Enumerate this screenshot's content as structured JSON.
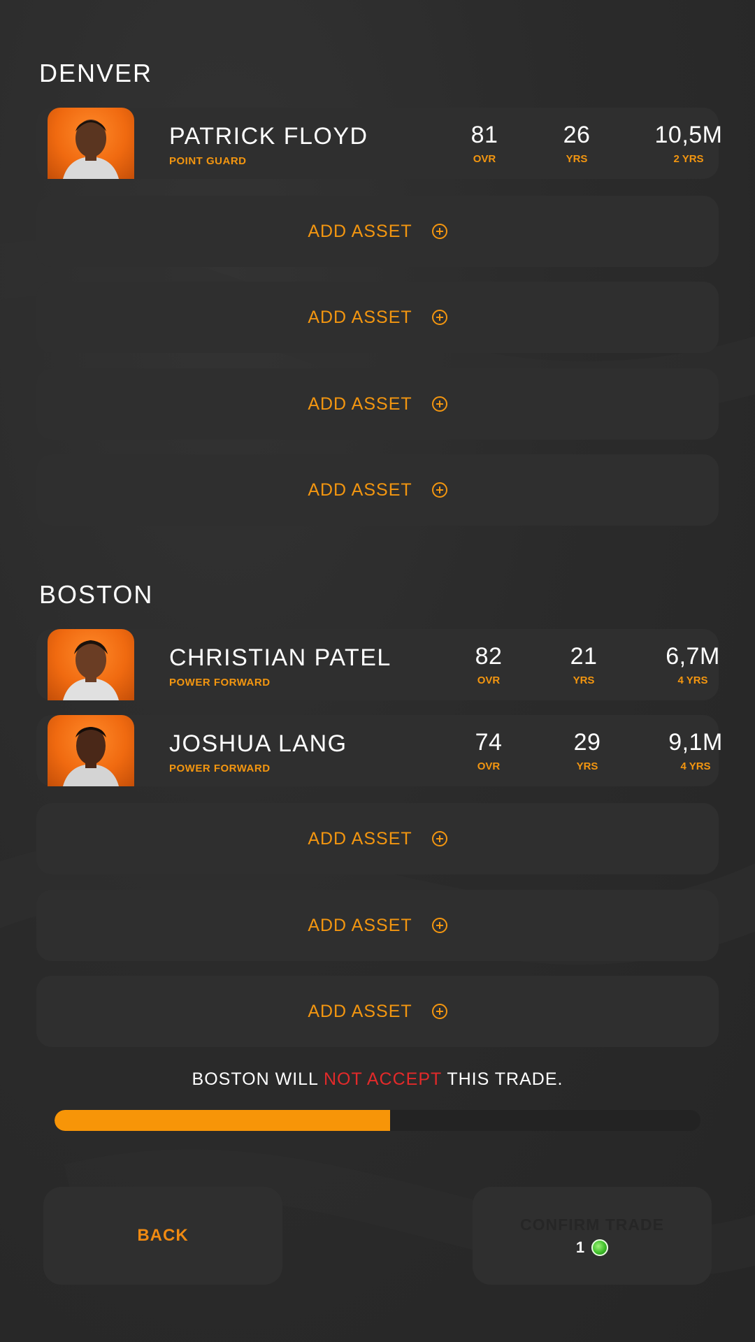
{
  "teams": [
    {
      "name": "DENVER",
      "players": [
        {
          "name": "PATRICK FLOYD",
          "position": "POINT GUARD",
          "ovr": "81",
          "ovr_label": "OVR",
          "age": "26",
          "age_label": "YRS",
          "salary": "10,5M",
          "contract": "2 YRS"
        }
      ],
      "add_slots": [
        "ADD ASSET",
        "ADD ASSET",
        "ADD ASSET",
        "ADD ASSET"
      ]
    },
    {
      "name": "BOSTON",
      "players": [
        {
          "name": "CHRISTIAN PATEL",
          "position": "POWER FORWARD",
          "ovr": "82",
          "ovr_label": "OVR",
          "age": "21",
          "age_label": "YRS",
          "salary": "6,7M",
          "contract": "4 YRS"
        },
        {
          "name": "JOSHUA LANG",
          "position": "POWER FORWARD",
          "ovr": "74",
          "ovr_label": "OVR",
          "age": "29",
          "age_label": "YRS",
          "salary": "9,1M",
          "contract": "4 YRS"
        }
      ],
      "add_slots": [
        "ADD ASSET",
        "ADD ASSET",
        "ADD ASSET"
      ]
    }
  ],
  "verdict": {
    "prefix": "BOSTON WILL ",
    "highlight": "NOT ACCEPT",
    "suffix": " THIS TRADE."
  },
  "acceptance_progress": 0.52,
  "buttons": {
    "back": "BACK",
    "confirm": "CONFIRM TRADE",
    "confirm_cost": "1"
  },
  "icons": {
    "add": "plus-circle-icon",
    "currency": "green-gem-icon"
  },
  "colors": {
    "accent": "#f39610",
    "negative": "#e32a2a",
    "background": "#2a2a2a",
    "card": "#2f2f2f"
  }
}
